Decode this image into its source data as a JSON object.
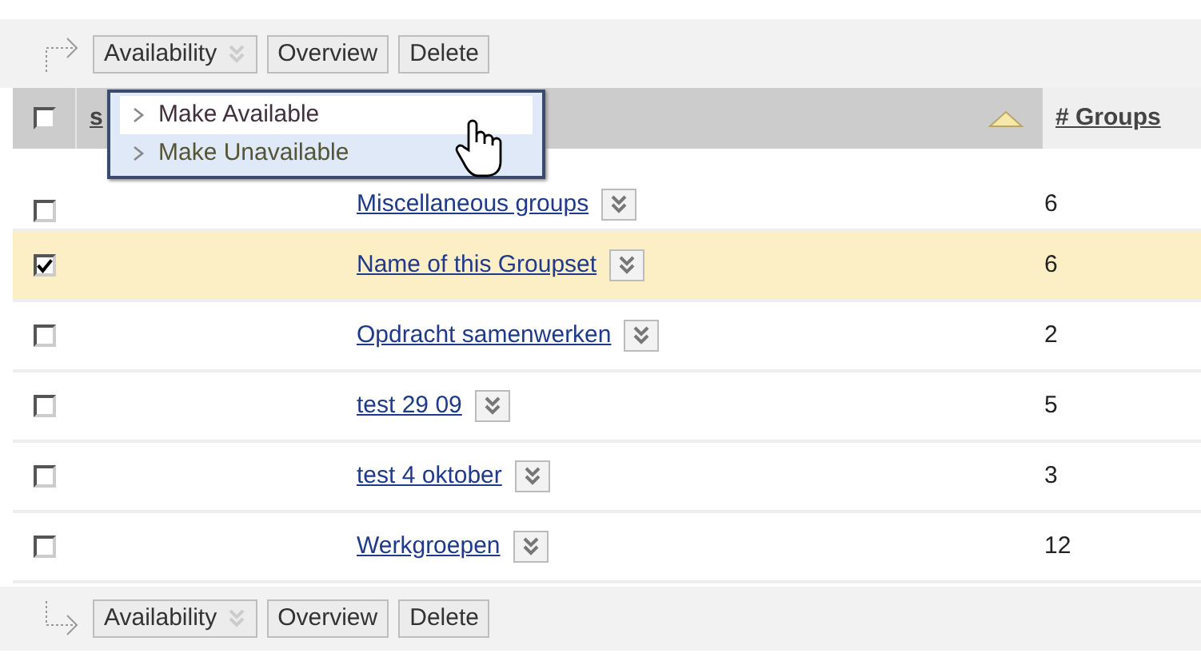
{
  "top_toolbar": {
    "buttons": [
      {
        "label": "Availability",
        "kind": "dropdown"
      },
      {
        "label": "Overview",
        "kind": "plain"
      },
      {
        "label": "Delete",
        "kind": "plain"
      }
    ]
  },
  "menu": {
    "items": [
      {
        "label": "Make Available",
        "selected": true
      },
      {
        "label": "Make Unavailable",
        "selected": false
      }
    ]
  },
  "table": {
    "select_all": {
      "checked": false
    },
    "columns": [
      {
        "label": "s",
        "sorted": false
      },
      {
        "label": "# Groups",
        "sorted": false
      }
    ],
    "name_sorted": true,
    "rows": [
      {
        "name": "Miscellaneous groups",
        "groups": "6",
        "checked": false
      },
      {
        "name": "Name of this Groupset",
        "groups": "6",
        "checked": true
      },
      {
        "name": "Opdracht samenwerken",
        "groups": "2",
        "checked": false
      },
      {
        "name": "test 29 09",
        "groups": "5",
        "checked": false
      },
      {
        "name": "test 4 oktober",
        "groups": "3",
        "checked": false
      },
      {
        "name": "Werkgroepen",
        "groups": "12",
        "checked": false
      }
    ]
  },
  "bottom_toolbar": {
    "buttons": [
      {
        "label": "Availability",
        "kind": "dropdown"
      },
      {
        "label": "Overview",
        "kind": "plain"
      },
      {
        "label": "Delete",
        "kind": "plain"
      }
    ]
  }
}
